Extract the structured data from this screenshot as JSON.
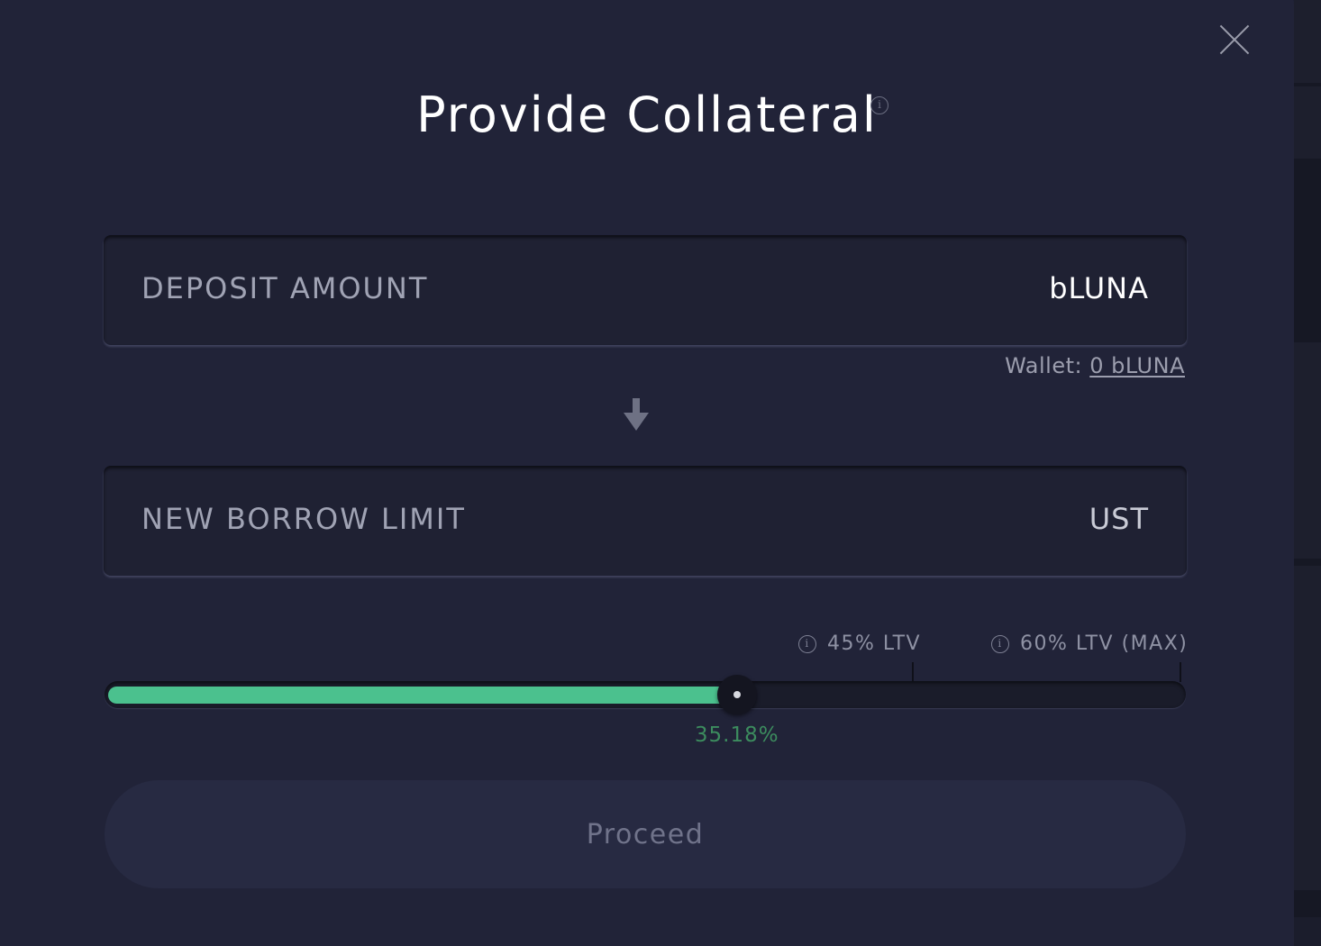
{
  "modal": {
    "title": "Provide Collateral",
    "title_info_glyph": "i"
  },
  "deposit": {
    "label": "DEPOSIT AMOUNT",
    "unit": "bLUNA",
    "wallet_label": "Wallet:",
    "wallet_value": "0 bLUNA"
  },
  "borrow_limit": {
    "label": "NEW BORROW LIMIT",
    "unit": "UST"
  },
  "ltv_slider": {
    "value_label": "35.18%",
    "value_percent": 35.18,
    "scale_max_percent": 60,
    "markers": [
      {
        "label": "45% LTV",
        "percent": 45
      },
      {
        "label": "60% LTV (MAX)",
        "percent": 60
      }
    ],
    "info_glyph": "i"
  },
  "actions": {
    "proceed_label": "Proceed"
  },
  "icons": {
    "close": "close-icon",
    "info": "info-icon",
    "arrow": "arrow-down-icon"
  },
  "colors": {
    "modal_bg": "#212338",
    "field_bg": "#1f2133",
    "slider_fill": "#4bc18e",
    "slider_value_text": "#3c8c5e",
    "button_bg": "#272a42"
  }
}
